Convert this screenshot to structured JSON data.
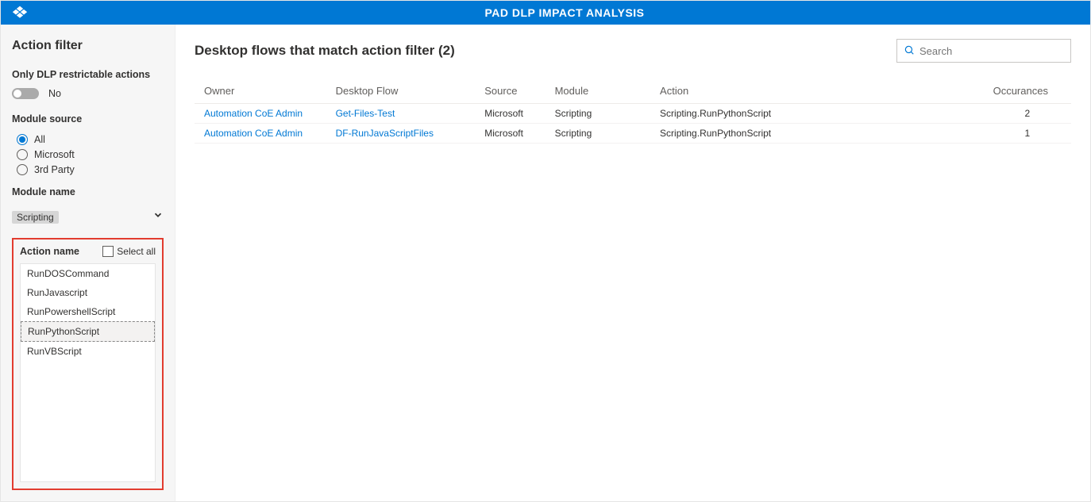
{
  "header": {
    "title": "PAD DLP IMPACT ANALYSIS"
  },
  "sidebar": {
    "title": "Action filter",
    "dlp_label": "Only DLP restrictable actions",
    "dlp_toggle_value": "No",
    "module_source_label": "Module source",
    "module_source_options": [
      "All",
      "Microsoft",
      "3rd Party"
    ],
    "module_source_selected": "All",
    "module_name_label": "Module name",
    "module_name_selected": "Scripting",
    "action_name_label": "Action name",
    "select_all_label": "Select all",
    "action_name_options": [
      "RunDOSCommand",
      "RunJavascript",
      "RunPowershellScript",
      "RunPythonScript",
      "RunVBScript"
    ],
    "action_name_selected": "RunPythonScript"
  },
  "main": {
    "title": "Desktop flows that match action filter (2)",
    "search_placeholder": "Search",
    "columns": {
      "owner": "Owner",
      "flow": "Desktop Flow",
      "source": "Source",
      "module": "Module",
      "action": "Action",
      "occurrences": "Occurances"
    },
    "rows": [
      {
        "owner": "Automation CoE Admin",
        "flow": "Get-Files-Test",
        "source": "Microsoft",
        "module": "Scripting",
        "action": "Scripting.RunPythonScript",
        "occurrences": "2"
      },
      {
        "owner": "Automation CoE Admin",
        "flow": "DF-RunJavaScriptFiles",
        "source": "Microsoft",
        "module": "Scripting",
        "action": "Scripting.RunPythonScript",
        "occurrences": "1"
      }
    ]
  }
}
